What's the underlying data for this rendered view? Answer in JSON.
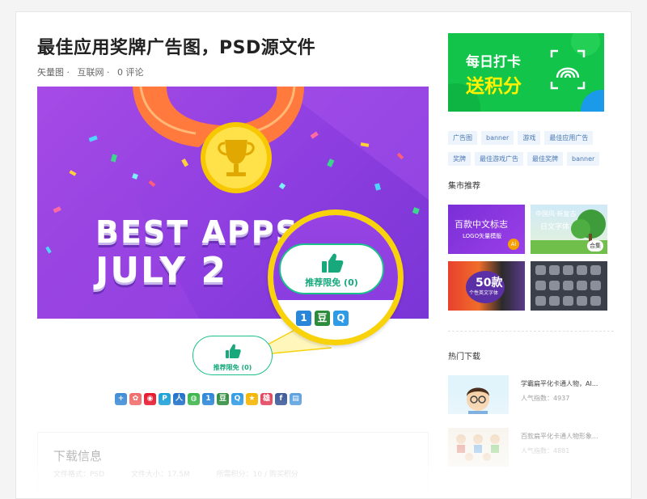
{
  "article": {
    "title": "最佳应用奖牌广告图，PSD源文件",
    "meta": [
      "矢量图 ·",
      "互联网 ·",
      "0 评论"
    ]
  },
  "banner": {
    "line1": "BEST APPS",
    "line2": "JULY 2",
    "magnifier_button_label": "推荐限免 (0)"
  },
  "recommend_button": {
    "label": "推荐限免 (0)"
  },
  "share_icons": [
    {
      "name": "share-more-icon",
      "glyph": "+",
      "color": "#3d8bd6"
    },
    {
      "name": "share-qzone-icon",
      "glyph": "✿",
      "color": "#f06a6a"
    },
    {
      "name": "share-weibo-icon",
      "glyph": "◉",
      "color": "#e6162d"
    },
    {
      "name": "share-pinterest-icon",
      "glyph": "P",
      "color": "#1aa0d8"
    },
    {
      "name": "share-renren-icon",
      "glyph": "人",
      "color": "#1f6fc9"
    },
    {
      "name": "share-wechat-icon",
      "glyph": "◍",
      "color": "#3ab54a"
    },
    {
      "name": "share-kaixin-icon",
      "glyph": "1",
      "color": "#2a86d8"
    },
    {
      "name": "share-douban-icon",
      "glyph": "豆",
      "color": "#2d8b3c"
    },
    {
      "name": "share-qq-icon",
      "glyph": "Q",
      "color": "#2f9ae6"
    },
    {
      "name": "share-star-icon",
      "glyph": "★",
      "color": "#f5b400"
    },
    {
      "name": "share-tieba-icon",
      "glyph": "雄",
      "color": "#e2405a"
    },
    {
      "name": "share-facebook-icon",
      "glyph": "f",
      "color": "#3b5998"
    },
    {
      "name": "share-print-icon",
      "glyph": "▤",
      "color": "#5aa0e0"
    }
  ],
  "magnifier_icons": [
    {
      "name": "mag-kaixin-icon",
      "glyph": "1",
      "color": "#2a86d8"
    },
    {
      "name": "mag-douban-icon",
      "glyph": "豆",
      "color": "#2d8b3c"
    },
    {
      "name": "mag-qq-icon",
      "glyph": "Q",
      "color": "#2f9ae6"
    }
  ],
  "download_info": {
    "title": "下载信息",
    "fields": [
      "文件格式：PSD",
      "文件大小：17.5M",
      "所需积分：10 / 购买积分"
    ]
  },
  "sidebar": {
    "promo": {
      "line1": "每日打卡",
      "line2": "送积分"
    },
    "tags": [
      "广告图",
      "banner",
      "游戏",
      "最佳应用广告",
      "奖牌",
      "最佳游戏广告",
      "最佳奖牌",
      "banner"
    ],
    "market_title": "集市推荐",
    "market_items": [
      {
        "line1": "百款中文标志",
        "line2": "LOGO矢量模版",
        "badge": "Ai"
      },
      {
        "line1": "中国风·新复古",
        "line2": "日文字体",
        "badge": "合集"
      },
      {
        "line1": "50款",
        "line2": "个性英文字体",
        "badge": ""
      },
      {
        "line1": "",
        "line2": "",
        "badge": ""
      }
    ],
    "hot_title": "热门下载",
    "hot_items": [
      {
        "name": "学霸扁平化卡通人物，AI...",
        "popularity": "人气指数：4937"
      },
      {
        "name": "百款扁平化卡通人物形象...",
        "popularity": "人气指数：4881"
      }
    ]
  },
  "colors": {
    "accent_green": "#1bbf8c",
    "promo_green": "#12c54a",
    "medal_gold": "#f8d20b",
    "banner_purple": "#8e3ee0"
  }
}
